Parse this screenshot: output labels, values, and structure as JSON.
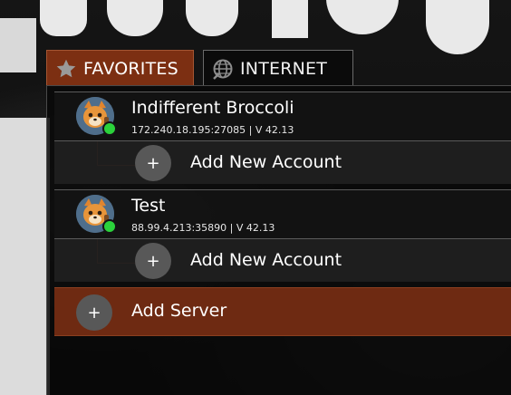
{
  "tabs": [
    {
      "label": "FAVORITES",
      "icon": "star-icon",
      "active": true
    },
    {
      "label": "INTERNET",
      "icon": "globe-icon",
      "active": false
    }
  ],
  "servers": [
    {
      "name": "Indifferent Broccoli",
      "info": "172.240.18.195:27085 | V 42.13",
      "status": "online",
      "add_account_label": "Add New Account"
    },
    {
      "name": "Test",
      "info": "88.99.4.213:35890 | V 42.13",
      "status": "online",
      "add_account_label": "Add New Account"
    }
  ],
  "add_server": {
    "label": "Add Server"
  },
  "plus_glyph": "+",
  "colors": {
    "accent": "#7c2f12",
    "online": "#2bd23b",
    "button": "#585858"
  }
}
